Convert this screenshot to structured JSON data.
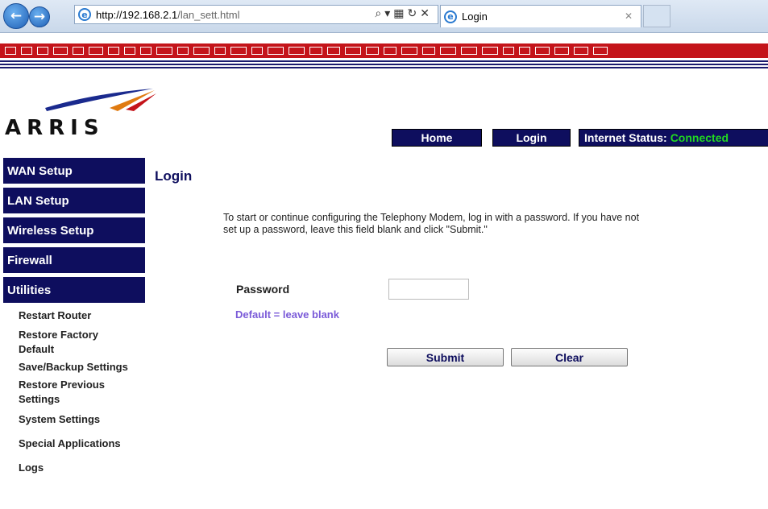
{
  "browser": {
    "url_host": "http://192.168.2.1",
    "url_path": "/lan_sett.html",
    "tab_title": "Login"
  },
  "brand": {
    "logo_text": "ARRIS"
  },
  "top_nav": {
    "home": "Home",
    "login": "Login",
    "status_label": "Internet Status:",
    "status_value": "Connected",
    "status_color": "#21d821"
  },
  "sidebar": {
    "main_items": [
      {
        "label": "WAN Setup"
      },
      {
        "label": "LAN Setup"
      },
      {
        "label": "Wireless Setup"
      },
      {
        "label": "Firewall"
      },
      {
        "label": "Utilities"
      }
    ],
    "sub_items": [
      {
        "label": "Restart Router"
      },
      {
        "label": "Restore Factory Default"
      },
      {
        "label": "Save/Backup Settings"
      },
      {
        "label": "Restore Previous Settings"
      },
      {
        "label": "System Settings"
      },
      {
        "label": "Special Applications"
      },
      {
        "label": "Logs"
      }
    ]
  },
  "main": {
    "title": "Login",
    "intro": "To start or continue configuring the Telephony Modem, log in with a password. If you have not set up a password, leave this field blank and click \"Submit.\"",
    "password_label": "Password",
    "password_value": "",
    "hint": "Default = leave blank",
    "submit": "Submit",
    "clear": "Clear"
  }
}
